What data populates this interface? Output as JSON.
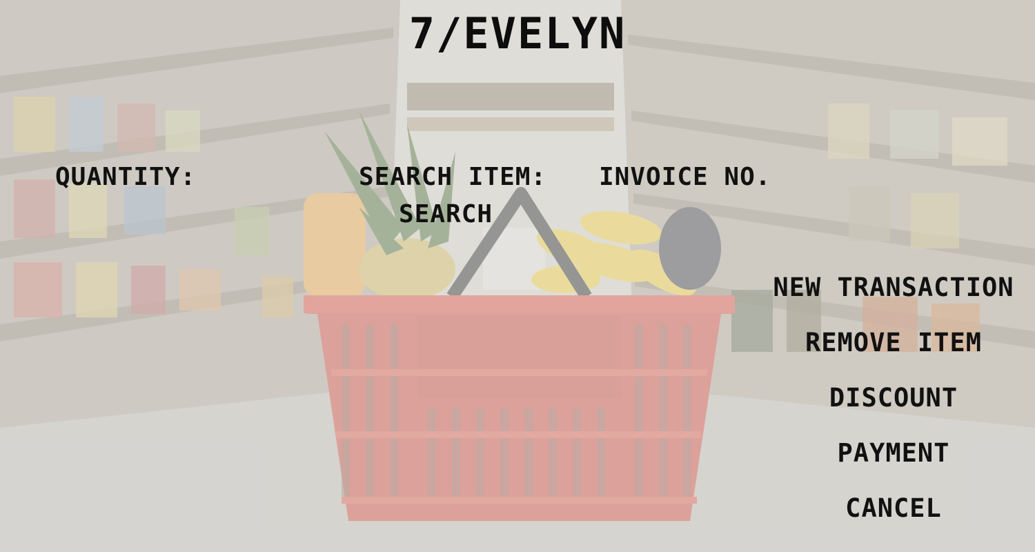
{
  "app": {
    "title": "7/EVELYN"
  },
  "form": {
    "quantity_label": "QUANTITY:",
    "search_item_label": "SEARCH ITEM:",
    "invoice_label": "INVOICE NO.",
    "search_button": "SEARCH"
  },
  "menu": {
    "new_transaction": "NEW TRANSACTION",
    "remove_item": "REMOVE ITEM",
    "discount": "DISCOUNT",
    "payment": "PAYMENT",
    "cancel": "CANCEL"
  },
  "colors": {
    "text": "#111111",
    "basket": "#c8463a",
    "overlay": "#ecece9"
  }
}
